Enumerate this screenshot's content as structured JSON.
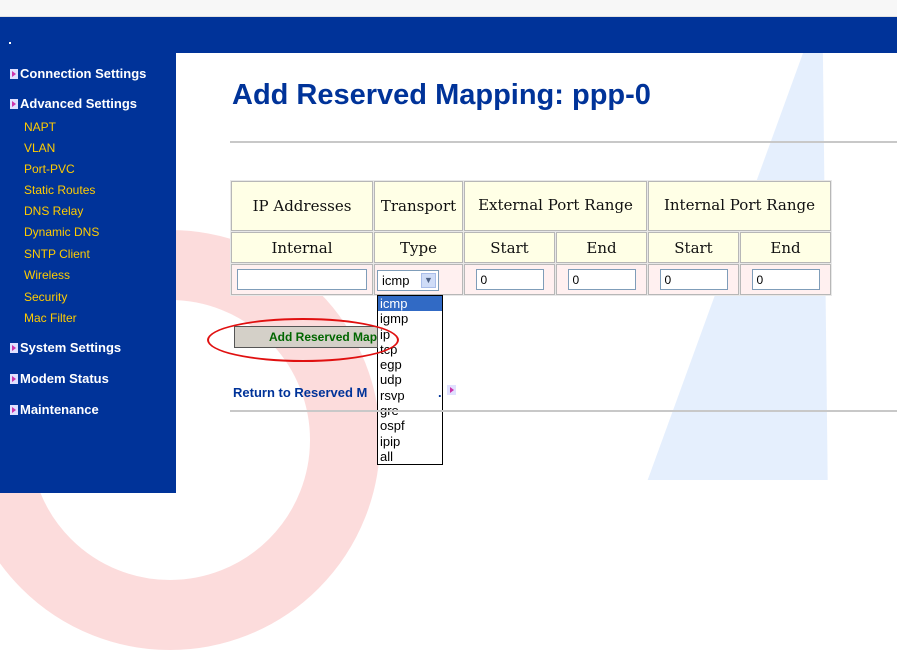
{
  "sidebar": {
    "main_items": [
      {
        "label": "Connection Settings"
      },
      {
        "label": "Advanced Settings"
      },
      {
        "label": "System Settings"
      },
      {
        "label": "Modem Status"
      },
      {
        "label": "Maintenance"
      }
    ],
    "sub_items": [
      {
        "label": "NAPT"
      },
      {
        "label": "VLAN"
      },
      {
        "label": "Port-PVC"
      },
      {
        "label": "Static Routes"
      },
      {
        "label": "DNS Relay"
      },
      {
        "label": "Dynamic DNS"
      },
      {
        "label": "SNTP Client"
      },
      {
        "label": "Wireless"
      },
      {
        "label": "Security"
      },
      {
        "label": "Mac Filter"
      }
    ]
  },
  "page": {
    "title": "Add Reserved Mapping: ppp-0"
  },
  "table": {
    "header1": [
      "IP Addresses",
      "Transport",
      "External Port Range",
      "Internal Port Range"
    ],
    "header2": [
      "Internal",
      "Type",
      "Start",
      "End",
      "Start",
      "End"
    ],
    "inputs": {
      "internal_ip": "",
      "ext_start": "0",
      "ext_end": "0",
      "int_start": "0",
      "int_end": "0"
    },
    "transport_selected": "icmp",
    "transport_options": [
      "icmp",
      "igmp",
      "ip",
      "tcp",
      "egp",
      "udp",
      "rsvp",
      "gre",
      "ospf",
      "ipip",
      "all"
    ]
  },
  "buttons": {
    "add_label": "Add Reserved Mapping"
  },
  "links": {
    "return_label": "Return to Reserved M",
    "return_tail": "."
  },
  "colors": {
    "banner": "#003399",
    "sub_menu": "#ffcc00",
    "title": "#003399",
    "highlight": "#316ac5"
  }
}
